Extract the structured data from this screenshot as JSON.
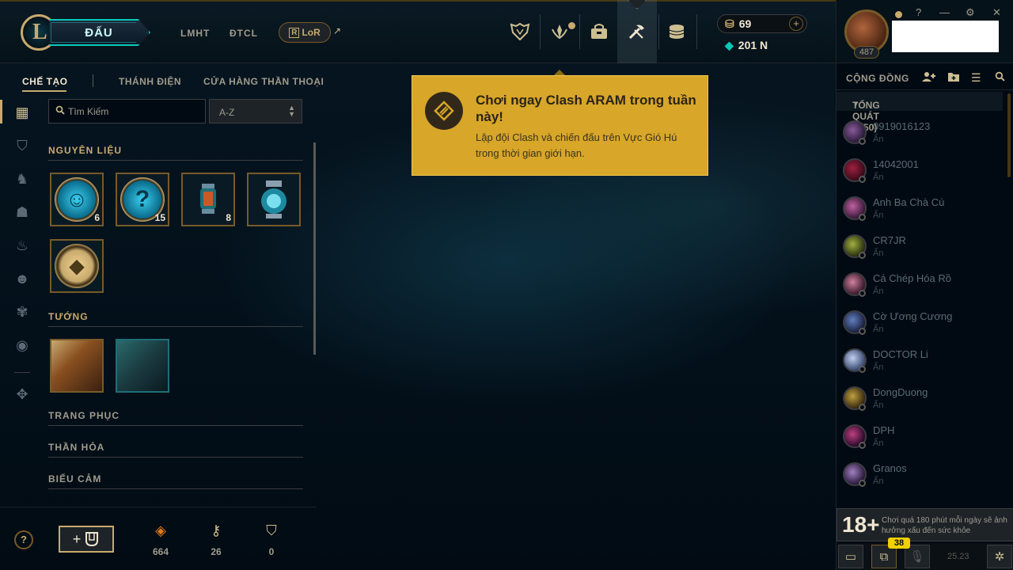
{
  "top": {
    "logo_letter": "L",
    "play_label": "ĐẤU",
    "nav_links": [
      "LMHT",
      "ĐTCL"
    ],
    "lor_label": "LoR",
    "lor_r": "R",
    "ext_arrow": "↗",
    "currency": {
      "rp": "69",
      "be": "201 N",
      "plus": "+"
    },
    "icons": [
      "worlds-icon",
      "honor-icon",
      "store-bag-icon",
      "loot-crafting-icon",
      "coins-icon"
    ]
  },
  "subnav": {
    "items": [
      "CHẾ TẠO",
      "THÁNH ĐIỆN",
      "CỬA HÀNG THẦN THOẠI"
    ]
  },
  "loot": {
    "search_placeholder": "Tìm Kiếm",
    "sort_value": "A-Z",
    "sections": {
      "materials": "NGUYÊN LIỆU",
      "champions": "TƯỚNG",
      "skins": "TRANG PHỤC",
      "wards": "THẦN HỎA",
      "emotes": "BIỂU CẢM"
    },
    "materials": [
      {
        "name": "emote-token",
        "count": "6"
      },
      {
        "name": "mystery-token",
        "count": "15"
      },
      {
        "name": "capsule-small",
        "count": "8"
      },
      {
        "name": "capsule-large",
        "count": ""
      },
      {
        "name": "hextech-key-fragment",
        "count": ""
      }
    ],
    "resources": [
      {
        "icon": "orange-essence-icon",
        "count": "664"
      },
      {
        "icon": "key-icon",
        "count": "26"
      },
      {
        "icon": "chest-icon",
        "count": "0"
      }
    ],
    "help": "?",
    "craft_plus": "+"
  },
  "promo": {
    "title": "Chơi ngay Clash ARAM trong tuần này!",
    "body": "Lập đội Clash và chiến đấu trên Vực Gió Hú trong thời gian giới hạn."
  },
  "social": {
    "level": "487",
    "window_controls": [
      "?",
      "—",
      "⚙",
      "✕"
    ],
    "title": "CỘNG ĐỒNG",
    "group": "TỔNG QUÁT (0/50)",
    "group_arrow": "▼",
    "friends": [
      {
        "name": "0919016123",
        "status": "Ẩn"
      },
      {
        "name": "14042001",
        "status": "Ẩn"
      },
      {
        "name": "Anh Ba Chà Cú",
        "status": "Ẩn"
      },
      {
        "name": "CR7JR",
        "status": "Ẩn"
      },
      {
        "name": "Cá Chép Hóa Rồ",
        "status": "Ẩn"
      },
      {
        "name": "Cờ Ương Cương",
        "status": "Ẩn"
      },
      {
        "name": "DOCTOR Li",
        "status": "Ẩn"
      },
      {
        "name": "DongDuong",
        "status": "Ẩn"
      },
      {
        "name": "DPH",
        "status": "Ẩn"
      },
      {
        "name": "Granos",
        "status": "Ẩn"
      }
    ],
    "warning_age": "18+",
    "warning_text": "Chơi quá 180 phút mỗi ngày sẽ ảnh hưởng xấu đến sức khỏe",
    "badge": "38",
    "version": "25.23"
  },
  "colors": {
    "gold": "#c8aa6e",
    "teal": "#0ac8b9",
    "promo": "#d8a628",
    "bg": "#010a13"
  }
}
